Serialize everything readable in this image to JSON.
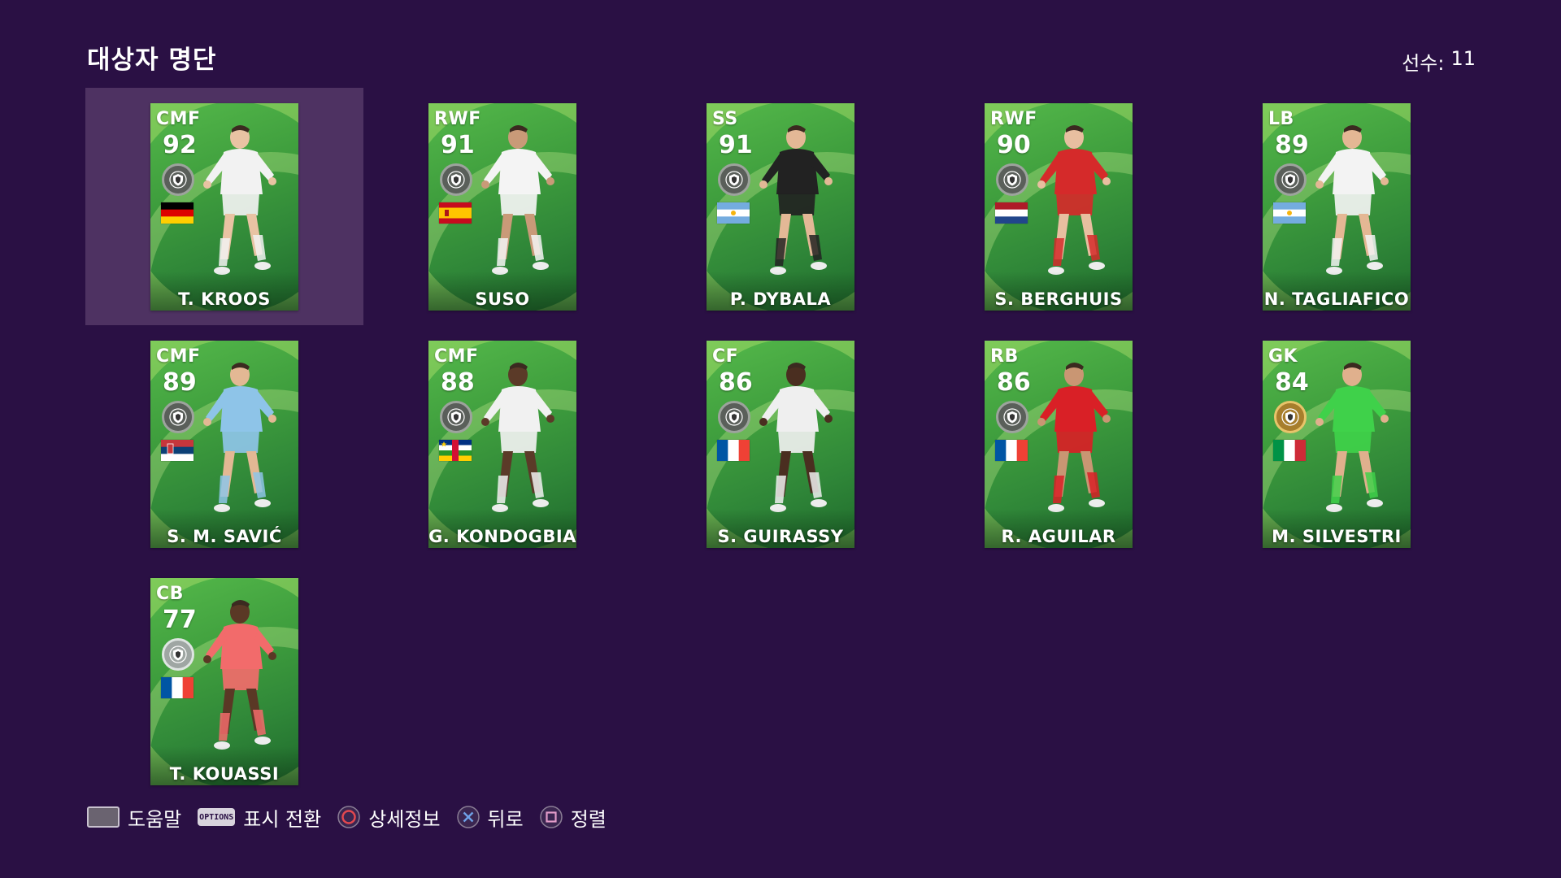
{
  "header": {
    "title": "대상자 명단",
    "count_label": "선수:",
    "count_value": "11"
  },
  "players": [
    {
      "position": "CMF",
      "rating": "92",
      "name": "T. KROOS",
      "flag": "germany",
      "badge": "black",
      "kit": "#f2f2f2",
      "skin": "#e9c3a3"
    },
    {
      "position": "RWF",
      "rating": "91",
      "name": "SUSO",
      "flag": "spain",
      "badge": "black",
      "kit": "#f4f4f4",
      "skin": "#c99a78"
    },
    {
      "position": "SS",
      "rating": "91",
      "name": "P. DYBALA",
      "flag": "argentina",
      "badge": "black",
      "kit": "#222222",
      "skin": "#e3b896"
    },
    {
      "position": "RWF",
      "rating": "90",
      "name": "S. BERGHUIS",
      "flag": "netherlands",
      "badge": "black",
      "kit": "#d52a2a",
      "skin": "#e8bfa0"
    },
    {
      "position": "LB",
      "rating": "89",
      "name": "N. TAGLIAFICO",
      "flag": "argentina",
      "badge": "black",
      "kit": "#f3f3f3",
      "skin": "#e4b794"
    },
    {
      "position": "CMF",
      "rating": "89",
      "name": "S. M. SAVIĆ",
      "flag": "serbia",
      "badge": "black",
      "kit": "#8ec4e8",
      "skin": "#e3b894"
    },
    {
      "position": "CMF",
      "rating": "88",
      "name": "G. KONDOGBIA",
      "flag": "central-african-republic",
      "badge": "black",
      "kit": "#f1f1f1",
      "skin": "#5b3a28"
    },
    {
      "position": "CF",
      "rating": "86",
      "name": "S. GUIRASSY",
      "flag": "france",
      "badge": "black",
      "kit": "#efefef",
      "skin": "#4a2e20"
    },
    {
      "position": "RB",
      "rating": "86",
      "name": "R. AGUILAR",
      "flag": "france",
      "badge": "black",
      "kit": "#d92026",
      "skin": "#c99673"
    },
    {
      "position": "GK",
      "rating": "84",
      "name": "M. SILVESTRI",
      "flag": "italy",
      "badge": "gold",
      "kit": "#3fd14a",
      "skin": "#e0b08d"
    },
    {
      "position": "CB",
      "rating": "77",
      "name": "T. KOUASSI",
      "flag": "france",
      "badge": "silver",
      "kit": "#f26b6b",
      "skin": "#5a3825"
    }
  ],
  "hints": [
    {
      "button": "touchpad-icon",
      "label": "도움말"
    },
    {
      "button": "options-icon",
      "button_text": "OPTIONS",
      "label": "표시 전환"
    },
    {
      "button": "circle-icon",
      "label": "상세정보"
    },
    {
      "button": "cross-icon",
      "label": "뒤로"
    },
    {
      "button": "square-icon",
      "label": "정렬"
    }
  ],
  "colors": {
    "background": "#2a1044",
    "selection": "#4e3262",
    "card_green": "#3e9d3d",
    "circle": "#e2484f",
    "cross": "#6fa0e6",
    "square": "#e29bc9"
  }
}
